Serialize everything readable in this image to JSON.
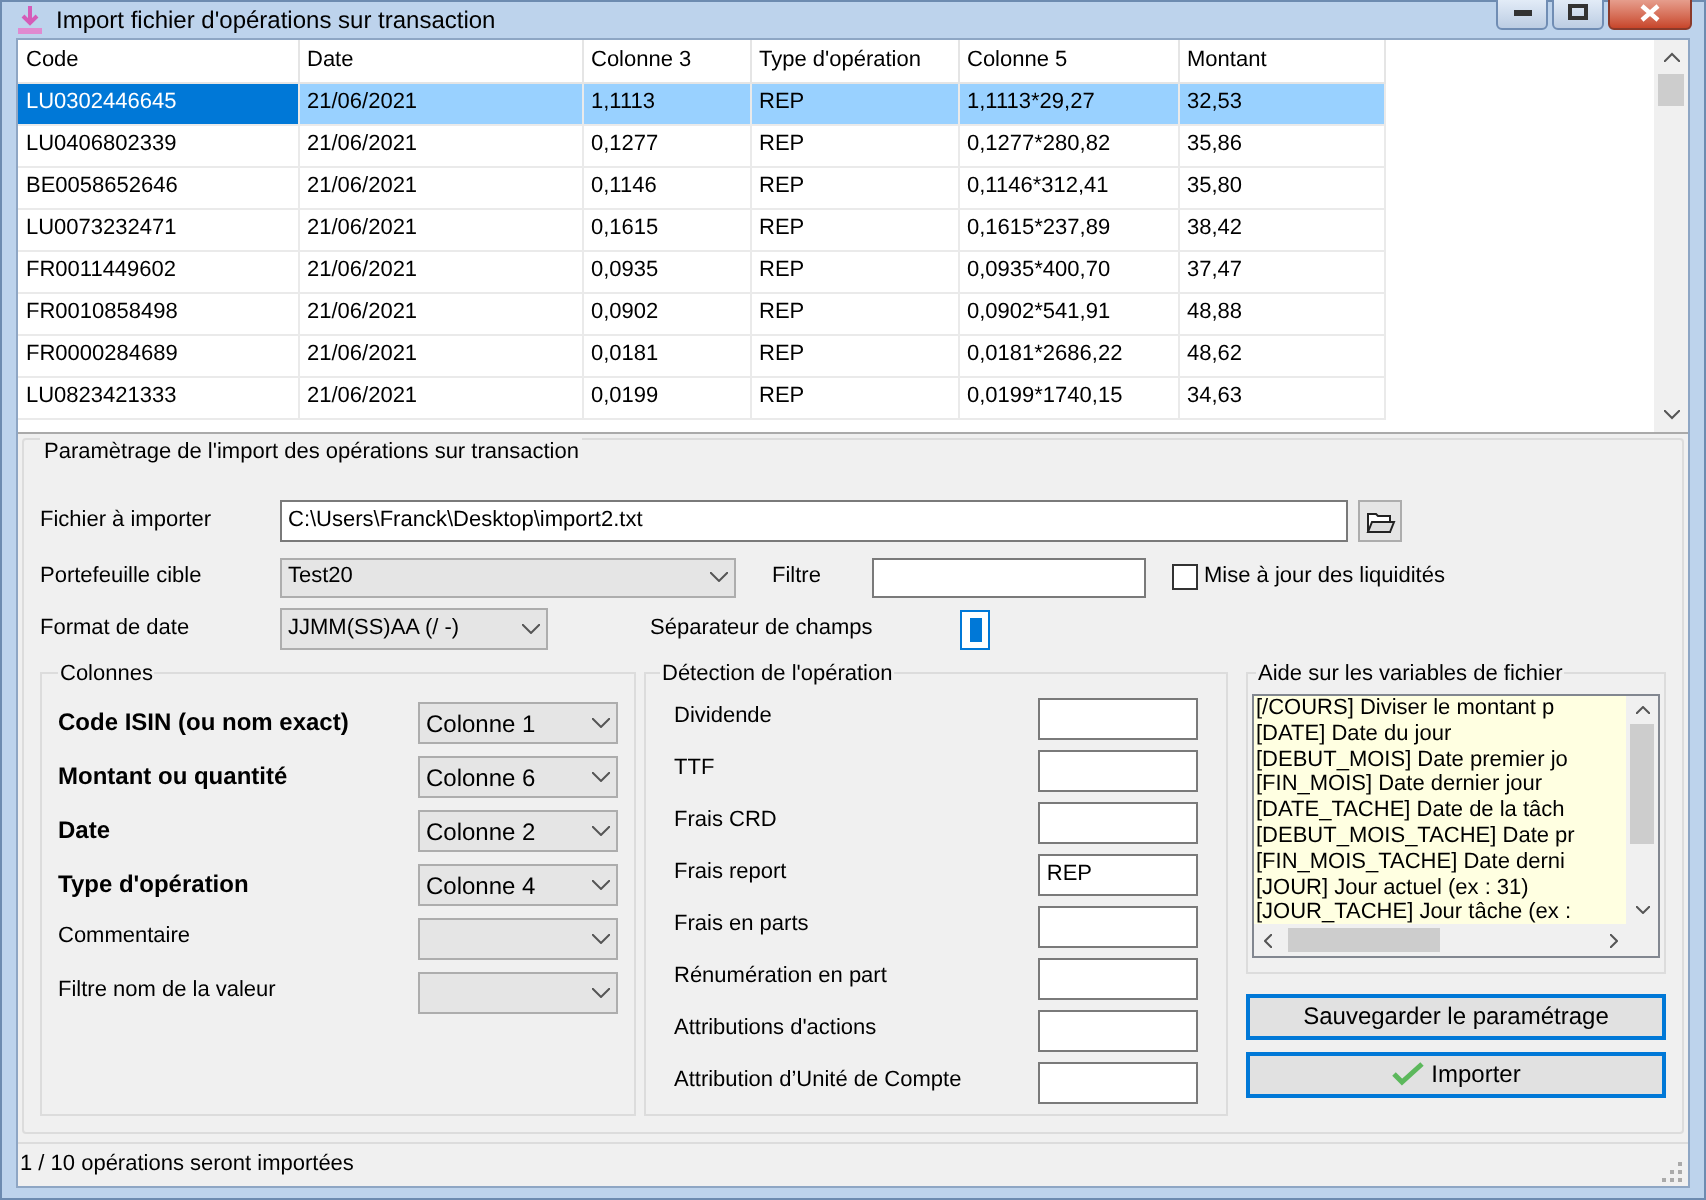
{
  "window": {
    "title": "Import fichier d'opérations sur transaction"
  },
  "table": {
    "columns": [
      "Code",
      "Date",
      "Colonne 3",
      "Type d'opération",
      "Colonne 5",
      "Montant"
    ],
    "rows": [
      {
        "cells": [
          "LU0302446645",
          "21/06/2021",
          "1,1113",
          "REP",
          "1,1113*29,27",
          "32,53"
        ],
        "selected": true
      },
      {
        "cells": [
          "LU0406802339",
          "21/06/2021",
          "0,1277",
          "REP",
          "0,1277*280,82",
          "35,86"
        ],
        "selected": false
      },
      {
        "cells": [
          "BE0058652646",
          "21/06/2021",
          "0,1146",
          "REP",
          "0,1146*312,41",
          "35,80"
        ],
        "selected": false
      },
      {
        "cells": [
          "LU0073232471",
          "21/06/2021",
          "0,1615",
          "REP",
          "0,1615*237,89",
          "38,42"
        ],
        "selected": false
      },
      {
        "cells": [
          "FR0011449602",
          "21/06/2021",
          "0,0935",
          "REP",
          "0,0935*400,70",
          "37,47"
        ],
        "selected": false
      },
      {
        "cells": [
          "FR0010858498",
          "21/06/2021",
          "0,0902",
          "REP",
          "0,0902*541,91",
          "48,88"
        ],
        "selected": false
      },
      {
        "cells": [
          "FR0000284689",
          "21/06/2021",
          "0,0181",
          "REP",
          "0,0181*2686,22",
          "48,62"
        ],
        "selected": false
      },
      {
        "cells": [
          "LU0823421333",
          "21/06/2021",
          "0,0199",
          "REP",
          "0,0199*1740,15",
          "34,63"
        ],
        "selected": false
      }
    ]
  },
  "settings": {
    "title": "Paramètrage de l'import des opérations sur transaction",
    "file": {
      "label": "Fichier à importer",
      "value": "C:\\Users\\Franck\\Desktop\\import2.txt"
    },
    "portfolio": {
      "label": "Portefeuille cible",
      "value": "Test20"
    },
    "filter": {
      "label": "Filtre"
    },
    "update_cash": {
      "label": "Mise à jour des liquidités",
      "checked": false
    },
    "date_format": {
      "label": "Format de date",
      "value": "JJMM(SS)AA (/ -)"
    },
    "separator": {
      "label": "Séparateur de champs"
    }
  },
  "columns_group": {
    "title": "Colonnes",
    "items": [
      {
        "label": "Code ISIN (ou nom exact)",
        "required": true,
        "value": "Colonne 1"
      },
      {
        "label": "Montant ou quantité",
        "required": true,
        "value": "Colonne 6"
      },
      {
        "label": "Date",
        "required": true,
        "value": "Colonne 2"
      },
      {
        "label": "Type d'opération",
        "required": true,
        "value": "Colonne 4"
      },
      {
        "label": "Commentaire",
        "required": false
      },
      {
        "label": "Filtre nom de la valeur",
        "required": false
      }
    ]
  },
  "detection_group": {
    "title": "Détection de l'opération",
    "items": [
      {
        "label": "Dividende"
      },
      {
        "label": "TTF"
      },
      {
        "label": "Frais CRD"
      },
      {
        "label": "Frais report",
        "value": "REP"
      },
      {
        "label": "Frais en parts"
      },
      {
        "label": "Rénumération en part"
      },
      {
        "label": "Attributions d'actions"
      },
      {
        "label": "Attribution d’Unité de Compte"
      }
    ]
  },
  "help_group": {
    "title": "Aide sur les variables de fichier",
    "items": [
      "[/COURS] Diviser le montant p",
      "[DATE] Date du jour",
      "[DEBUT_MOIS] Date premier jo",
      "[FIN_MOIS] Date dernier jour",
      "[DATE_TACHE] Date de la tâch",
      "[DEBUT_MOIS_TACHE] Date pr",
      "[FIN_MOIS_TACHE] Date derni",
      "[JOUR] Jour actuel (ex : 31)",
      "[JOUR_TACHE] Jour tâche (ex :"
    ]
  },
  "buttons": [
    {
      "label": "Sauvegarder le paramétrage",
      "kind": "plain"
    },
    {
      "label": "Importer",
      "kind": "check"
    }
  ],
  "status_bar": "1 / 10 opérations seront importées"
}
